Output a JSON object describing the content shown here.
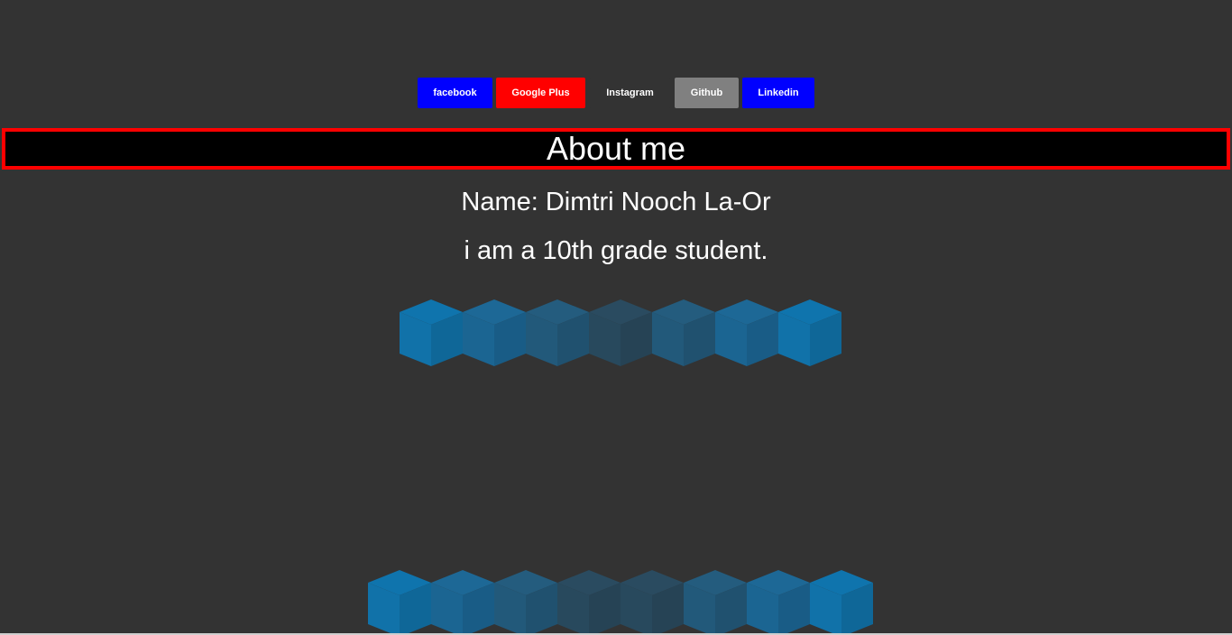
{
  "nav": {
    "buttons": [
      {
        "label": "facebook",
        "color": "#0000ff",
        "width": 83
      },
      {
        "label": "Google Plus",
        "color": "#ff0000",
        "width": 99
      },
      {
        "label": "Instagram",
        "color": "#333333",
        "width": 91
      },
      {
        "label": "Github",
        "color": "#808080",
        "width": 71
      },
      {
        "label": "Linkedin",
        "color": "#0000ff",
        "width": 80
      }
    ]
  },
  "about": {
    "heading": "About me",
    "name_line": "Name: Dimtri Nooch La-Or",
    "grade_line": "i am a 10th grade student."
  },
  "colors": {
    "cube_light": "#1483c8",
    "cube_mid": "#1f6b99",
    "cube_dark": "#2a4f66",
    "highlight_border": "#ff0000"
  }
}
